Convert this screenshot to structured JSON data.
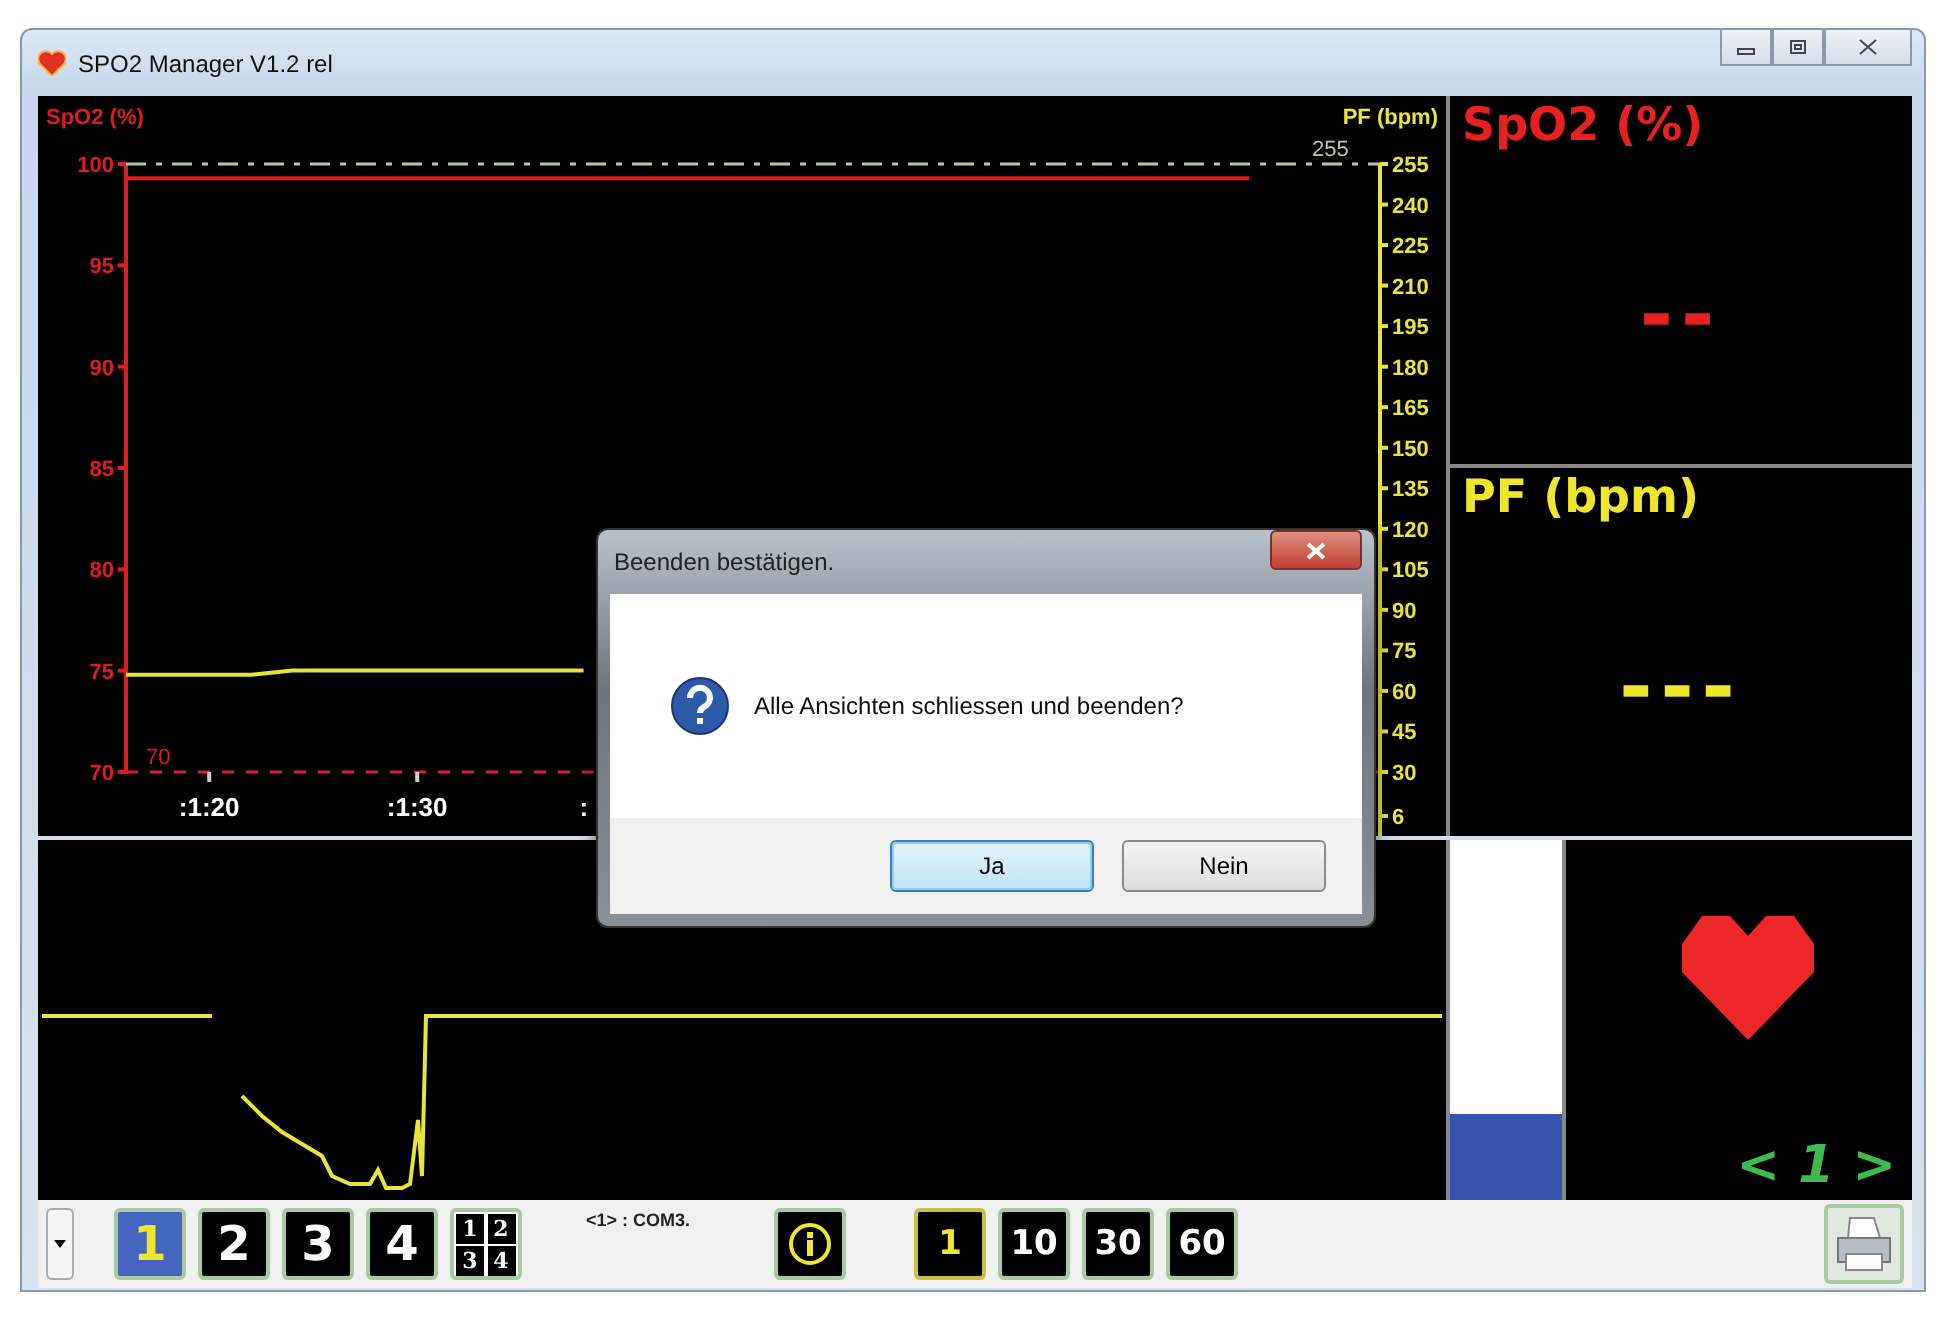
{
  "window": {
    "title": "SPO2 Manager V1.2 rel"
  },
  "trend": {
    "right_axis_title": "PF (bpm)",
    "covered_tick_label": ":",
    "pf_limit_label": "255",
    "right_ticks": [
      "255",
      "240",
      "225",
      "210",
      "195",
      "180",
      "165",
      "150",
      "135",
      "120",
      "105",
      "90",
      "75",
      "60",
      "45",
      "30",
      "6"
    ],
    "chart_data": {
      "type": "line",
      "ylabel": "SpO2 (%)",
      "ylim": [
        70,
        100
      ],
      "yticks": [
        70,
        75,
        80,
        85,
        90,
        95,
        100
      ],
      "categories": [
        null,
        null,
        ":1:20",
        null,
        null,
        null,
        null,
        ":1:30",
        null,
        null,
        null,
        null,
        null,
        null,
        null,
        null,
        null,
        null,
        null,
        null,
        null,
        null,
        null,
        null,
        null,
        null,
        null,
        null,
        null,
        null,
        null
      ],
      "series": [
        {
          "color": "#e01c1c",
          "values": [
            99.3,
            99.3,
            99.3,
            99.3,
            99.3,
            99.3,
            99.3,
            99.3,
            99.3,
            99.3,
            99.3,
            99.3,
            99.3,
            99.3,
            99.3,
            99.3,
            99.3,
            99.3,
            99.3,
            99.3,
            99.3,
            99.3,
            99.3,
            99.3,
            99.3,
            99.3,
            99.3,
            99.3,
            null,
            null,
            null
          ]
        },
        {
          "color": "#e8e43a",
          "values": [
            74.8,
            74.8,
            74.8,
            74.8,
            75,
            75,
            75,
            75,
            75,
            75,
            75,
            75,
            null,
            null,
            null,
            null,
            null,
            null,
            null,
            null,
            null,
            null,
            null,
            null,
            null,
            null,
            null,
            null,
            null,
            null,
            null
          ]
        }
      ],
      "ref_lines": [
        {
          "axis": "y",
          "value": 70,
          "label": "70"
        }
      ]
    }
  },
  "readouts": [
    {
      "title": "SpO2 (%)",
      "value": "--",
      "color": "#e82020"
    },
    {
      "title": "PF (bpm)",
      "value": "---",
      "color": "#f0e62a"
    }
  ],
  "signal": {
    "level": 0.24
  },
  "channel": {
    "label": "< 1 >"
  },
  "toolbar": {
    "view_buttons": [
      {
        "label": "1",
        "selected": true
      },
      {
        "label": "2",
        "selected": false
      },
      {
        "label": "3",
        "selected": false
      },
      {
        "label": "4",
        "selected": false
      }
    ],
    "quad_labels": [
      "1",
      "2",
      "3",
      "4"
    ],
    "port": "<1> : COM3.",
    "time_buttons": [
      {
        "label": "1",
        "selected": true
      },
      {
        "label": "10",
        "selected": false
      },
      {
        "label": "30",
        "selected": false
      },
      {
        "label": "60",
        "selected": false
      }
    ]
  },
  "dialog": {
    "title": "Beenden bestätigen.",
    "message": "Alle Ansichten schliessen und beenden?",
    "buttons": [
      {
        "label": "Ja",
        "selected": true
      },
      {
        "label": "Nein",
        "selected": false
      }
    ]
  }
}
